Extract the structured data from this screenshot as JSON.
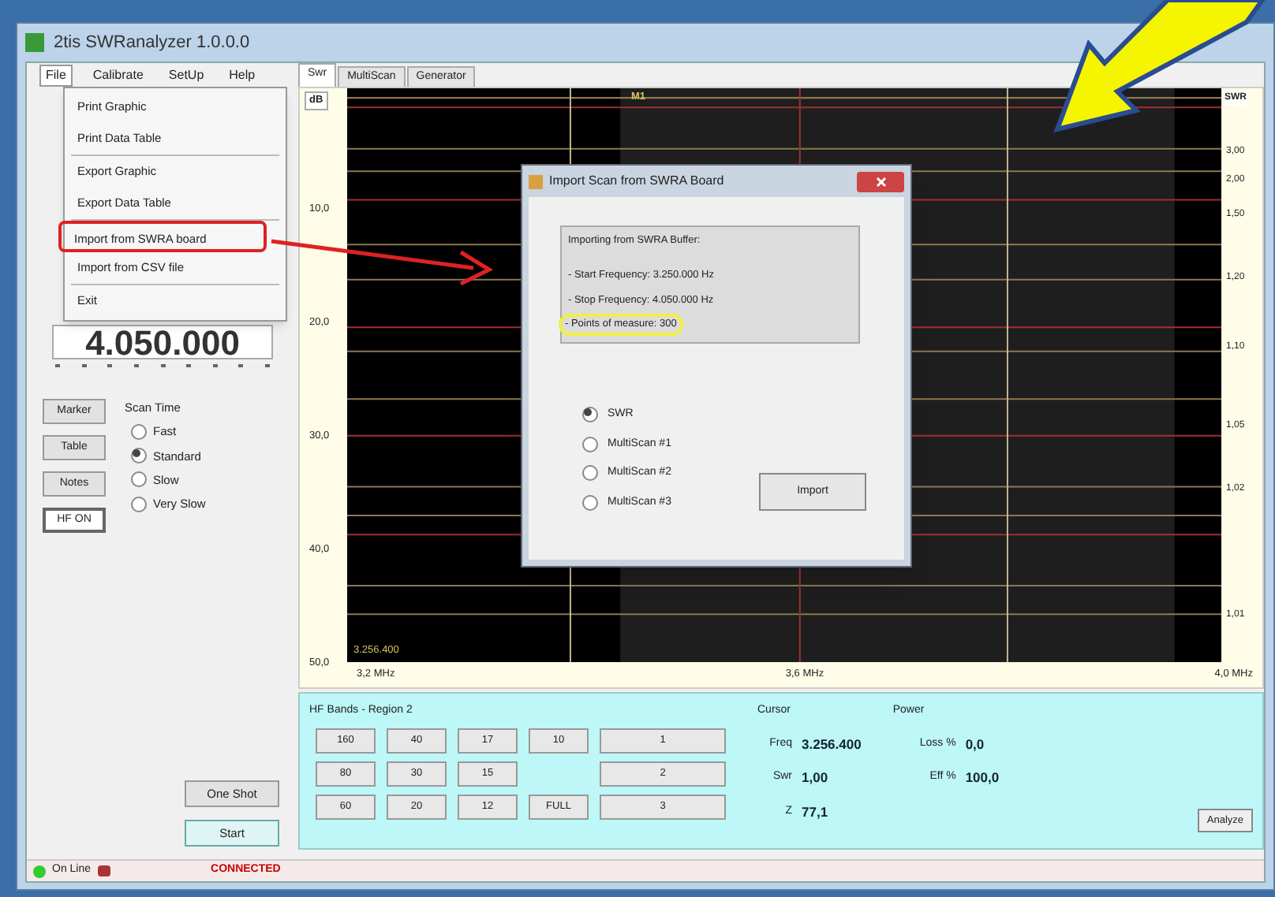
{
  "window": {
    "title": "2tis SWRanalyzer 1.0.0.0"
  },
  "menu_bar": [
    {
      "label": "File",
      "selected": true
    },
    {
      "label": "Calibrate",
      "selected": false
    },
    {
      "label": "SetUp",
      "selected": false
    },
    {
      "label": "Help",
      "selected": false
    }
  ],
  "file_menu": [
    {
      "label": "Print Graphic",
      "highlighted": false,
      "separator_after": false
    },
    {
      "label": "Print Data Table",
      "highlighted": false,
      "separator_after": true
    },
    {
      "label": "Export Graphic",
      "highlighted": false,
      "separator_after": false
    },
    {
      "label": "Export Data Table",
      "highlighted": false,
      "separator_after": true
    },
    {
      "label": "Import from SWRA board",
      "highlighted": true,
      "separator_after": false
    },
    {
      "label": "Import from CSV file",
      "highlighted": false,
      "separator_after": true
    },
    {
      "label": "Exit",
      "highlighted": false,
      "separator_after": false
    }
  ],
  "tabs": [
    {
      "label": "Swr",
      "selected": true
    },
    {
      "label": "MultiScan",
      "selected": false
    },
    {
      "label": "Generator",
      "selected": false
    }
  ],
  "frequency_display": "4.050.000",
  "side_buttons": [
    {
      "label": "Marker",
      "on": false
    },
    {
      "label": "Table",
      "on": false
    },
    {
      "label": "Notes",
      "on": false
    },
    {
      "label": "HF ON",
      "on": true
    }
  ],
  "scan_time": {
    "title": "Scan Time",
    "options": [
      {
        "label": "Fast",
        "selected": false
      },
      {
        "label": "Standard",
        "selected": true
      },
      {
        "label": "Slow",
        "selected": false
      },
      {
        "label": "Very Slow",
        "selected": false
      }
    ]
  },
  "plot": {
    "left_unit": "dB",
    "left_ticks": [
      "10,0",
      "20,0",
      "30,0",
      "40,0",
      "50,0"
    ],
    "right_unit": "SWR",
    "right_ticks": [
      "3,00",
      "2,00",
      "1,50",
      "1,20",
      "1,10",
      "1,05",
      "1,02",
      "1,01"
    ],
    "x_labels": [
      "3,2 MHz",
      "3,6 MHz",
      "4,0 MHz"
    ],
    "marker_label": "M1",
    "cursor_readout": "3.256.400"
  },
  "hf_bands": {
    "title": "HF Bands - Region 2",
    "rows": [
      [
        "160",
        "40",
        "17",
        "10",
        "1"
      ],
      [
        "80",
        "30",
        "15",
        "",
        "2"
      ],
      [
        "60",
        "20",
        "12",
        "FULL",
        "3"
      ]
    ]
  },
  "cursor": {
    "title": "Cursor",
    "fields": [
      {
        "label": "Freq",
        "value": "3.256.400"
      },
      {
        "label": "Swr",
        "value": "1,00"
      },
      {
        "label": "Z",
        "value": "77,1"
      }
    ]
  },
  "power": {
    "title": "Power",
    "fields": [
      {
        "label": "Loss %",
        "value": "0,0"
      },
      {
        "label": "Eff %",
        "value": "100,0"
      }
    ]
  },
  "analyze_button": "Analyze",
  "action_buttons": [
    "One Shot",
    "Start"
  ],
  "status_bar": {
    "online": "On Line",
    "connection": "CONNECTED"
  },
  "dialog": {
    "title": "Import Scan from SWRA Board",
    "log": [
      {
        "text": "Importing from SWRA Buffer:",
        "highlighted": false
      },
      {
        "text": "- Start Frequency: 3.250.000 Hz",
        "highlighted": false
      },
      {
        "text": "- Stop Frequency: 4.050.000 Hz",
        "highlighted": false
      },
      {
        "text": "- Points of measure: 300",
        "highlighted": true
      }
    ],
    "options": [
      {
        "label": "SWR",
        "selected": true
      },
      {
        "label": "MultiScan #1",
        "selected": false
      },
      {
        "label": "MultiScan #2",
        "selected": false
      },
      {
        "label": "MultiScan #3",
        "selected": false
      }
    ],
    "button": "Import"
  }
}
